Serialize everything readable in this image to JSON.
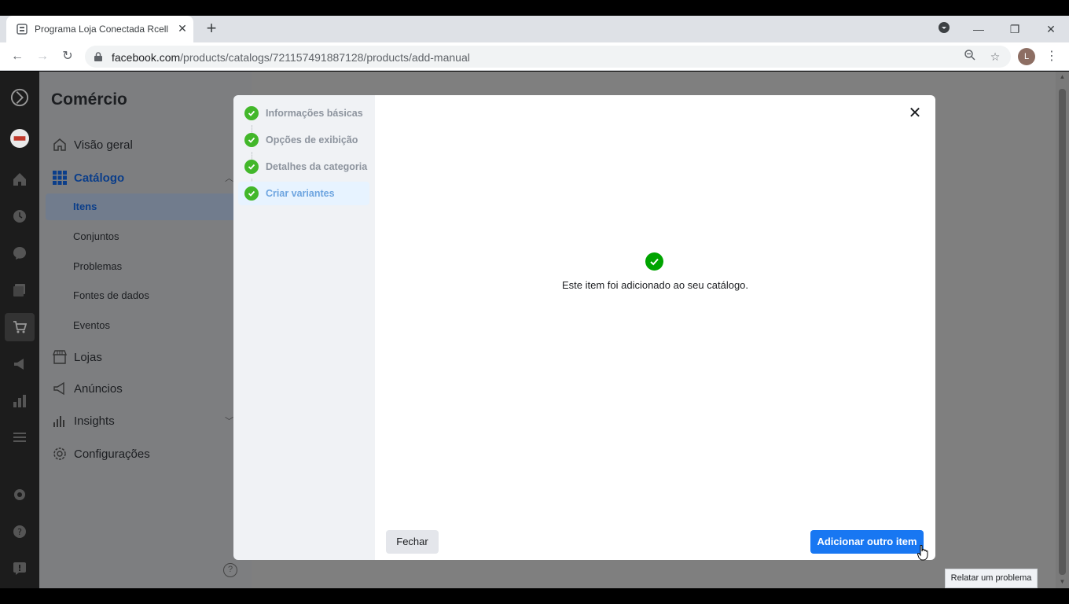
{
  "browser": {
    "tab_title": "Programa Loja Conectada Rcell",
    "url_host": "facebook.com",
    "url_path": "/products/catalogs/721157491887128/products/add-manual",
    "profile_initial": "L"
  },
  "sidebar": {
    "title": "Comércio",
    "items": {
      "overview": "Visão geral",
      "catalog": "Catálogo",
      "items": "Itens",
      "sets": "Conjuntos",
      "problems": "Problemas",
      "data_sources": "Fontes de dados",
      "events": "Eventos",
      "stores": "Lojas",
      "ads": "Anúncios",
      "insights": "Insights",
      "settings": "Configurações"
    },
    "help": "?"
  },
  "modal": {
    "steps": [
      {
        "label": "Informações básicas"
      },
      {
        "label": "Opções de exibição"
      },
      {
        "label": "Detalhes da categoria"
      },
      {
        "label": "Criar variantes"
      }
    ],
    "success_message": "Este item foi adicionado ao seu catálogo.",
    "close_button": "Fechar",
    "add_button": "Adicionar outro item"
  },
  "report_button": "Relatar um problema",
  "colors": {
    "primary": "#1877f2",
    "success": "#00a400",
    "step_check": "#42b72a"
  }
}
